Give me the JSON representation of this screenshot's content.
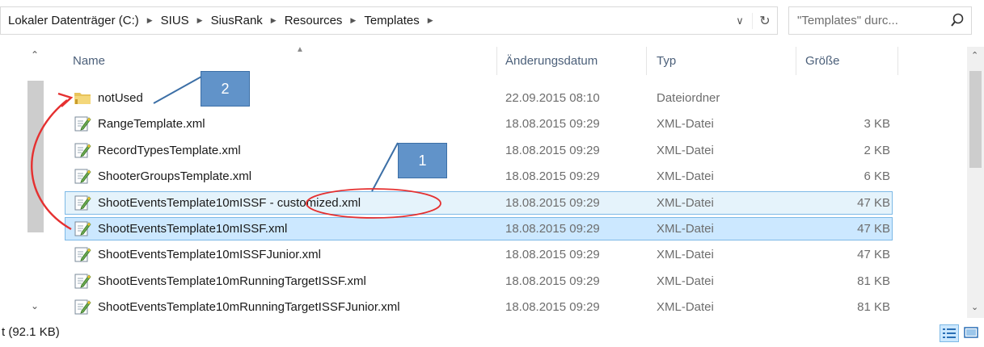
{
  "addressbar": {
    "crumbs": [
      "Lokaler Datenträger (C:)",
      "SIUS",
      "SiusRank",
      "Resources",
      "Templates"
    ]
  },
  "search": {
    "placeholder": "\"Templates\" durc..."
  },
  "columns": {
    "name": "Name",
    "date": "Änderungsdatum",
    "type": "Typ",
    "size": "Größe"
  },
  "files": [
    {
      "name": "notUsed",
      "date": "22.09.2015 08:10",
      "type": "Dateiordner",
      "size": "",
      "icon": "folder-icon"
    },
    {
      "name": "RangeTemplate.xml",
      "date": "18.08.2015 09:29",
      "type": "XML-Datei",
      "size": "3 KB",
      "icon": "xml-file-icon"
    },
    {
      "name": "RecordTypesTemplate.xml",
      "date": "18.08.2015 09:29",
      "type": "XML-Datei",
      "size": "2 KB",
      "icon": "xml-file-icon"
    },
    {
      "name": "ShooterGroupsTemplate.xml",
      "date": "18.08.2015 09:29",
      "type": "XML-Datei",
      "size": "6 KB",
      "icon": "xml-file-icon"
    },
    {
      "name": "ShootEventsTemplate10mISSF - customized.xml",
      "date": "18.08.2015 09:29",
      "type": "XML-Datei",
      "size": "47 KB",
      "icon": "xml-file-icon",
      "state": "selected"
    },
    {
      "name": "ShootEventsTemplate10mISSF.xml",
      "date": "18.08.2015 09:29",
      "type": "XML-Datei",
      "size": "47 KB",
      "icon": "xml-file-icon",
      "state": "selected-focused"
    },
    {
      "name": "ShootEventsTemplate10mISSFJunior.xml",
      "date": "18.08.2015 09:29",
      "type": "XML-Datei",
      "size": "47 KB",
      "icon": "xml-file-icon"
    },
    {
      "name": "ShootEventsTemplate10mRunningTargetISSF.xml",
      "date": "18.08.2015 09:29",
      "type": "XML-Datei",
      "size": "81 KB",
      "icon": "xml-file-icon"
    },
    {
      "name": "ShootEventsTemplate10mRunningTargetISSFJunior.xml",
      "date": "18.08.2015 09:29",
      "type": "XML-Datei",
      "size": "81 KB",
      "icon": "xml-file-icon"
    }
  ],
  "status": {
    "text": "t (92.1 KB)"
  },
  "callouts": [
    {
      "label": "1"
    },
    {
      "label": "2"
    }
  ],
  "colors": {
    "selection": "#cce8ff",
    "selection_border": "#7db9e6",
    "callout": "#6193c9",
    "annotation_red": "#e53030",
    "header_text": "#4c607a"
  }
}
